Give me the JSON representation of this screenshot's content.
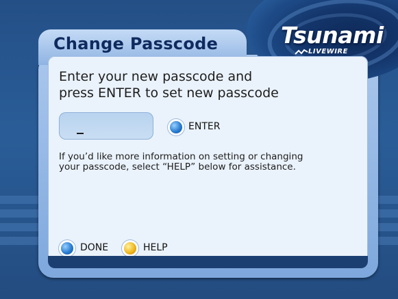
{
  "window": {
    "title": "Change Passcode"
  },
  "brand": {
    "name": "Tsunami",
    "subtitle": "LIVEWIRE"
  },
  "prompt": {
    "line1": "Enter your new passcode and",
    "line2": "press ENTER to set new passcode"
  },
  "passcode_field": {
    "value": "_"
  },
  "buttons": {
    "enter": "ENTER",
    "done": "DONE",
    "help": "HELP"
  },
  "info": {
    "line1": "If you’d like more information on setting or changing",
    "line2": "your passcode, select “HELP” below for assistance."
  },
  "colors": {
    "accent_blue": "#2a7ed3",
    "accent_yellow": "#f0b820",
    "title_text": "#0f2a5e"
  },
  "icons": {
    "enter": "blue-orb-icon",
    "done": "blue-orb-icon",
    "help": "yellow-orb-icon",
    "logo": "wave-icon"
  }
}
